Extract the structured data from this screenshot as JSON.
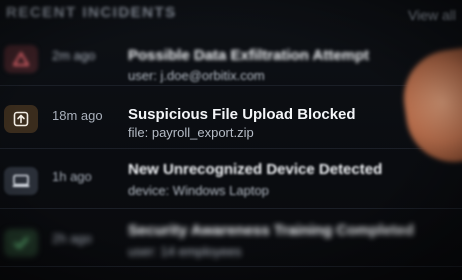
{
  "header": {
    "title": "RECENT INCIDENTS",
    "view_all": "View all"
  },
  "incidents": [
    {
      "time": "2m ago",
      "title": "Possible Data Exfiltration Attempt",
      "detail": "user: j.doe@orbitix.com",
      "icon": "warning-triangle-icon",
      "accent": "#e2575f"
    },
    {
      "time": "18m ago",
      "title": "Suspicious File Upload Blocked",
      "detail": "file: payroll_export.zip",
      "icon": "upload-icon",
      "accent": "#d9a25b"
    },
    {
      "time": "1h ago",
      "title": "New Unrecognized Device Detected",
      "detail": "device: Windows Laptop",
      "icon": "laptop-icon",
      "accent": "#9aa3b0"
    },
    {
      "time": "2h ago",
      "title": "Security Awareness Training Completed",
      "detail": "user: 14 employees",
      "icon": "checkmark-icon",
      "accent": "#5fbf7a"
    }
  ]
}
